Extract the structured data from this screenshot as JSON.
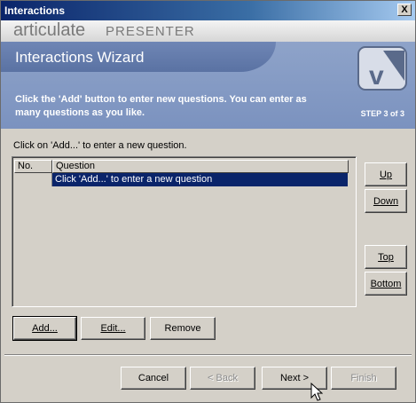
{
  "window": {
    "title": "Interactions",
    "close_label": "X"
  },
  "brand": {
    "articulate": "articulate",
    "presenter": "PRESENTER"
  },
  "banner": {
    "title": "Interactions Wizard",
    "instructions": "Click the 'Add' button to enter new questions.  You can enter as many questions as you like.",
    "step": "STEP 3 of 3",
    "logo_text": "v"
  },
  "hint": "Click on 'Add...' to enter a new question.",
  "table": {
    "columns": [
      "No.",
      "Question"
    ],
    "rows": [
      {
        "no": "",
        "question": "Click 'Add...' to enter a new question"
      }
    ]
  },
  "side_buttons": {
    "up": "Up",
    "down": "Down",
    "top": "Top",
    "bottom": "Bottom"
  },
  "action_buttons": {
    "add": "Add...",
    "edit": "Edit...",
    "remove": "Remove"
  },
  "footer_buttons": {
    "cancel": "Cancel",
    "back": "< Back",
    "next": "Next >",
    "finish": "Finish"
  },
  "colors": {
    "selection": "#0a246a",
    "banner": "#7b92bf",
    "titlebar": "#0a246a"
  }
}
